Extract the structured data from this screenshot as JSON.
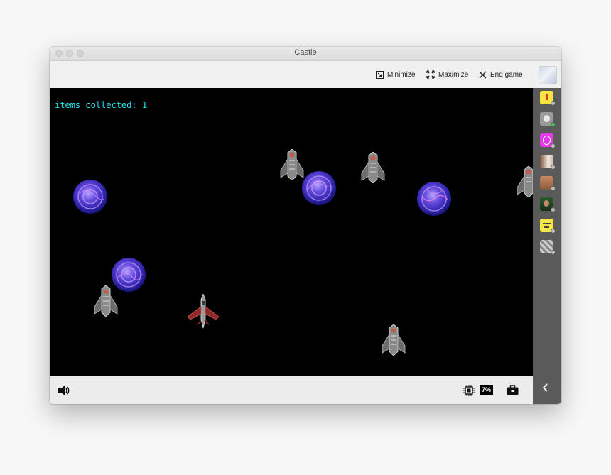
{
  "window": {
    "title": "Castle"
  },
  "toolbar": {
    "minimize_label": "Minimize",
    "maximize_label": "Maximize",
    "end_game_label": "End game"
  },
  "game": {
    "hud_text": "items collected: 1",
    "orb_count": 4,
    "enemy_count": 5,
    "player_ships": 1
  },
  "bottombar": {
    "cpu_percent": "7%",
    "icons": [
      "speaker-icon",
      "chip-icon",
      "toolbox-icon"
    ]
  },
  "sidebar": {
    "users": [
      {
        "avatar": "yellow",
        "status": "away"
      },
      {
        "avatar": "gray-face",
        "status": "online"
      },
      {
        "avatar": "pink",
        "status": "away"
      },
      {
        "avatar": "photo",
        "status": "away"
      },
      {
        "avatar": "brown",
        "status": "away"
      },
      {
        "avatar": "green-dark",
        "status": "away"
      },
      {
        "avatar": "yellow-face",
        "status": "away"
      },
      {
        "avatar": "gray-pattern",
        "status": "away"
      }
    ]
  },
  "colors": {
    "hud": "#22e5f0",
    "status_online": "#3cc64f",
    "status_away": "#bdbdbd",
    "game_bg": "#000000"
  }
}
